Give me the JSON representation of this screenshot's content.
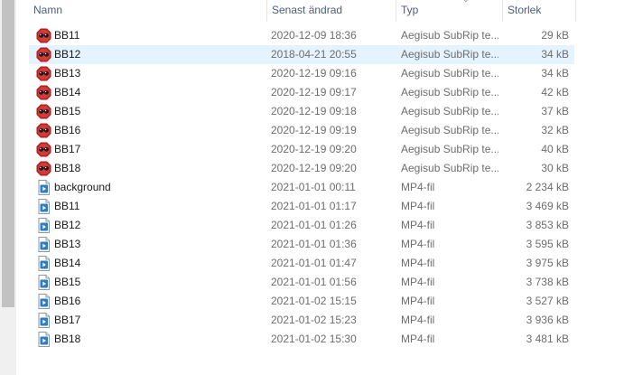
{
  "columns": {
    "name": "Namn",
    "modified": "Senast ändrad",
    "type": "Typ",
    "size": "Storlek"
  },
  "files": [
    {
      "name": "BB11",
      "modified": "2020-12-09 18:36",
      "type": "Aegisub SubRip te...",
      "size": "29 kB",
      "icon": "aegisub-subtitle-icon",
      "selected": false
    },
    {
      "name": "BB12",
      "modified": "2018-04-21 20:55",
      "type": "Aegisub SubRip te...",
      "size": "34 kB",
      "icon": "aegisub-subtitle-icon",
      "selected": true
    },
    {
      "name": "BB13",
      "modified": "2020-12-19 09:16",
      "type": "Aegisub SubRip te...",
      "size": "34 kB",
      "icon": "aegisub-subtitle-icon",
      "selected": false
    },
    {
      "name": "BB14",
      "modified": "2020-12-19 09:17",
      "type": "Aegisub SubRip te...",
      "size": "42 kB",
      "icon": "aegisub-subtitle-icon",
      "selected": false
    },
    {
      "name": "BB15",
      "modified": "2020-12-19 09:18",
      "type": "Aegisub SubRip te...",
      "size": "37 kB",
      "icon": "aegisub-subtitle-icon",
      "selected": false
    },
    {
      "name": "BB16",
      "modified": "2020-12-19 09:19",
      "type": "Aegisub SubRip te...",
      "size": "32 kB",
      "icon": "aegisub-subtitle-icon",
      "selected": false
    },
    {
      "name": "BB17",
      "modified": "2020-12-19 09:20",
      "type": "Aegisub SubRip te...",
      "size": "40 kB",
      "icon": "aegisub-subtitle-icon",
      "selected": false
    },
    {
      "name": "BB18",
      "modified": "2020-12-19 09:20",
      "type": "Aegisub SubRip te...",
      "size": "30 kB",
      "icon": "aegisub-subtitle-icon",
      "selected": false
    },
    {
      "name": "background",
      "modified": "2021-01-01 00:11",
      "type": "MP4-fil",
      "size": "2 234 kB",
      "icon": "mp4-video-file-icon",
      "selected": false
    },
    {
      "name": "BB11",
      "modified": "2021-01-01 01:17",
      "type": "MP4-fil",
      "size": "3 469 kB",
      "icon": "mp4-video-file-icon",
      "selected": false
    },
    {
      "name": "BB12",
      "modified": "2021-01-01 01:26",
      "type": "MP4-fil",
      "size": "3 853 kB",
      "icon": "mp4-video-file-icon",
      "selected": false
    },
    {
      "name": "BB13",
      "modified": "2021-01-01 01:36",
      "type": "MP4-fil",
      "size": "3 595 kB",
      "icon": "mp4-video-file-icon",
      "selected": false
    },
    {
      "name": "BB14",
      "modified": "2021-01-01 01:47",
      "type": "MP4-fil",
      "size": "3 975 kB",
      "icon": "mp4-video-file-icon",
      "selected": false
    },
    {
      "name": "BB15",
      "modified": "2021-01-01 01:56",
      "type": "MP4-fil",
      "size": "3 738 kB",
      "icon": "mp4-video-file-icon",
      "selected": false
    },
    {
      "name": "BB16",
      "modified": "2021-01-02 15:15",
      "type": "MP4-fil",
      "size": "3 527 kB",
      "icon": "mp4-video-file-icon",
      "selected": false
    },
    {
      "name": "BB17",
      "modified": "2021-01-02 15:23",
      "type": "MP4-fil",
      "size": "3 936 kB",
      "icon": "mp4-video-file-icon",
      "selected": false
    },
    {
      "name": "BB18",
      "modified": "2021-01-02 15:30",
      "type": "MP4-fil",
      "size": "3 481 kB",
      "icon": "mp4-video-file-icon",
      "selected": false
    }
  ],
  "colors": {
    "header_text": "#4c607a",
    "selection": "#e5f3ff",
    "secondary_text": "#6d6d6d",
    "aegisub_red": "#b21e1e",
    "video_blue": "#2f7cc5"
  }
}
